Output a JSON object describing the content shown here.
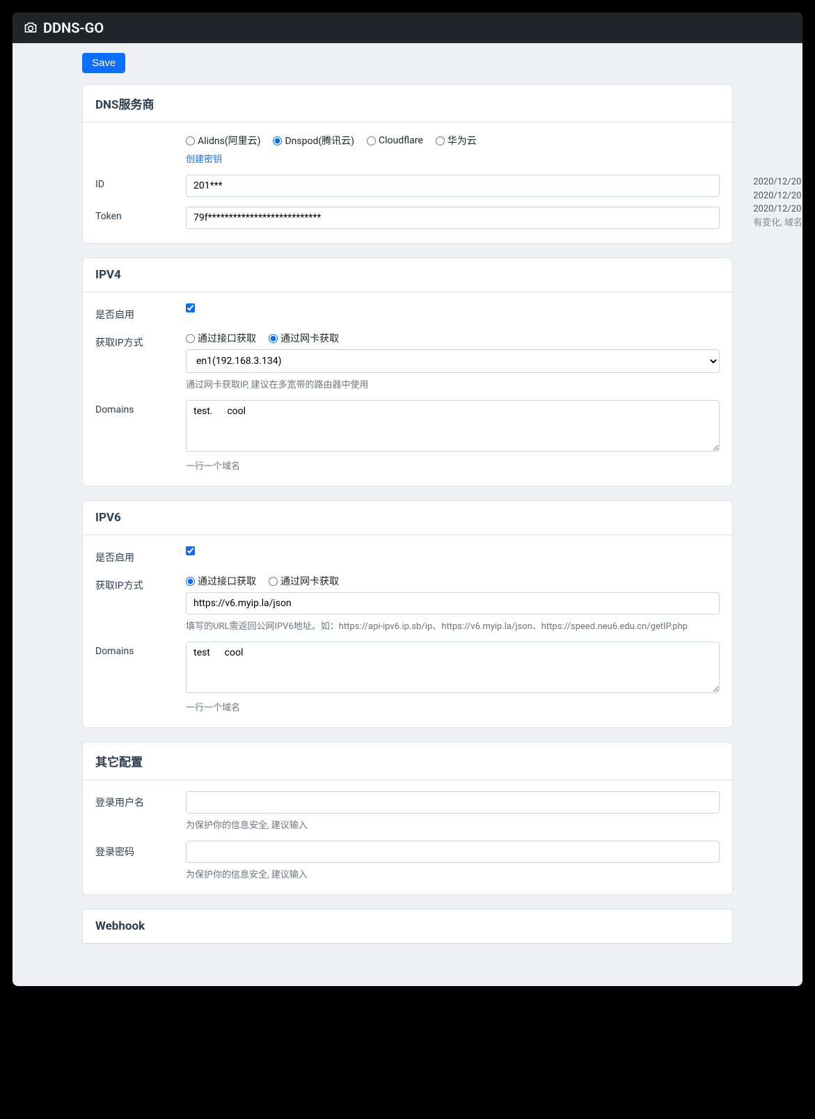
{
  "app": {
    "title": "DDNS-GO"
  },
  "save_label": "Save",
  "logs": [
    "2020/12/20",
    "2020/12/20",
    "2020/12/20",
    "有变化, 域名"
  ],
  "dns": {
    "title": "DNS服务商",
    "providers": [
      {
        "label": "Alidns(阿里云)",
        "selected": false
      },
      {
        "label": "Dnspod(腾讯云)",
        "selected": true
      },
      {
        "label": "Cloudflare",
        "selected": false
      },
      {
        "label": "华为云",
        "selected": false
      }
    ],
    "create_key": "创建密钥",
    "id_label": "ID",
    "id_value": "201***",
    "token_label": "Token",
    "token_value": "79f***************************"
  },
  "ipv4": {
    "title": "IPV4",
    "enable_label": "是否启用",
    "enabled": true,
    "method_label": "获取IP方式",
    "methods": [
      {
        "label": "通过接口获取",
        "selected": false
      },
      {
        "label": "通过网卡获取",
        "selected": true
      }
    ],
    "netcard_value": "en1(192.168.3.134)",
    "netcard_hint": "通过网卡获取IP, 建议在多宽带的路由器中使用",
    "domains_label": "Domains",
    "domains_value": "test.      cool",
    "domains_hint": "一行一个域名"
  },
  "ipv6": {
    "title": "IPV6",
    "enable_label": "是否启用",
    "enabled": true,
    "method_label": "获取IP方式",
    "methods": [
      {
        "label": "通过接口获取",
        "selected": true
      },
      {
        "label": "通过网卡获取",
        "selected": false
      }
    ],
    "url_value": "https://v6.myip.la/json",
    "url_hint": "填写的URL需返回公网IPV6地址。如：https://api-ipv6.ip.sb/ip、https://v6.myip.la/json、https://speed.neu6.edu.cn/getIP.php",
    "domains_label": "Domains",
    "domains_value": "test      cool",
    "domains_hint": "一行一个域名"
  },
  "other": {
    "title": "其它配置",
    "user_label": "登录用户名",
    "user_value": "",
    "user_hint": "为保护你的信息安全, 建议输入",
    "pass_label": "登录密码",
    "pass_value": "",
    "pass_hint": "为保护你的信息安全, 建议输入"
  },
  "webhook": {
    "title": "Webhook"
  }
}
